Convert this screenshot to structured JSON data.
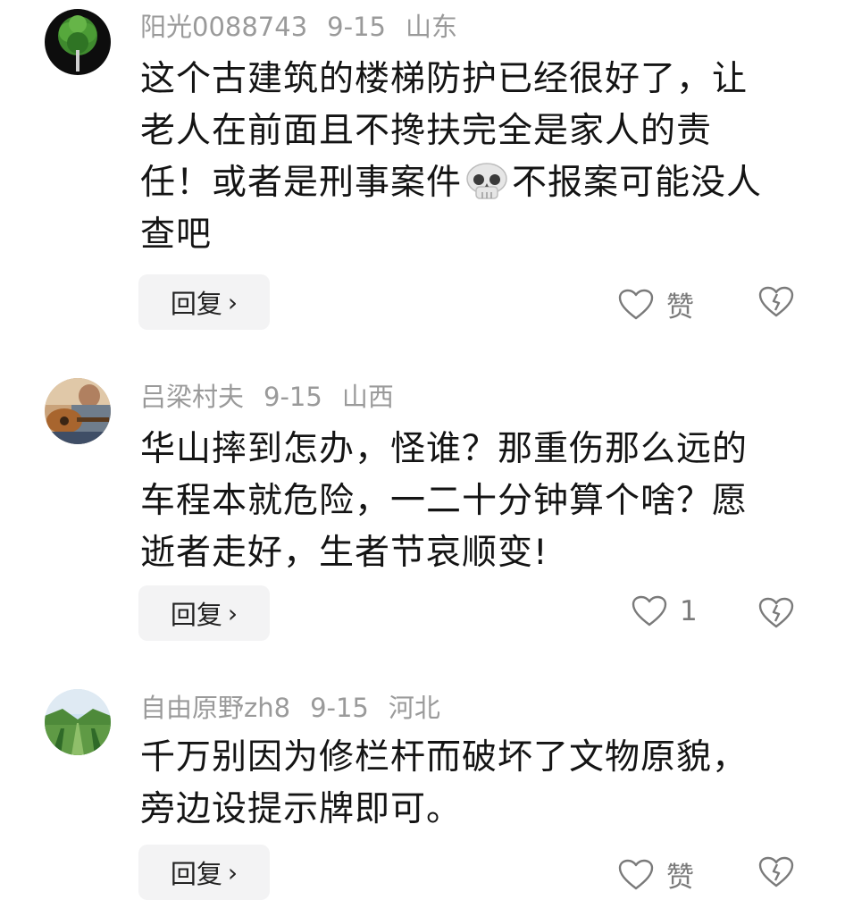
{
  "comments": [
    {
      "username": "阳光0088743",
      "date": "9-15",
      "location": "山东",
      "avatar": "tree-avatar",
      "lines": [
        "这个古建筑的楼梯防护已经很好了，让",
        "老人在前面且不搀扶完全是家人的责",
        "任！或者是刑事案件",
        "不报案可能没人",
        "查吧"
      ],
      "emoji": "skull-emoji",
      "reply_label": "回复",
      "like_label": "赞",
      "dislike_icon": "broken-heart-icon"
    },
    {
      "username": "吕梁村夫",
      "date": "9-15",
      "location": "山西",
      "avatar": "guitar-avatar",
      "lines": [
        "华山摔到怎办，怪谁？那重伤那么远的",
        "车程本就危险，一二十分钟算个啥？愿",
        "逝者走好，生者节哀顺变!"
      ],
      "reply_label": "回复",
      "like_label": "1",
      "dislike_icon": "broken-heart-icon"
    },
    {
      "username": "自由原野zh8",
      "date": "9-15",
      "location": "河北",
      "avatar": "landscape-avatar",
      "lines": [
        "千万别因为修栏杆而破坏了文物原貌，",
        "旁边设提示牌即可。"
      ],
      "reply_label": "回复",
      "like_label": "赞",
      "dislike_icon": "broken-heart-icon"
    }
  ],
  "ui": {
    "reply_chevron": "›",
    "text_color": "#141414",
    "meta_color": "#9a9a9a",
    "button_bg": "#f3f3f4"
  }
}
